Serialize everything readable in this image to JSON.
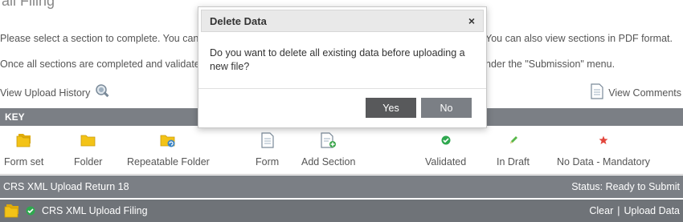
{
  "page": {
    "title": "ail Filing",
    "intro_line1_left": "Please select a section to complete. You can p",
    "intro_line1_right": "You can also view sections in PDF format.",
    "intro_line2_left": "Once all sections are completed and validated",
    "intro_line2_right": "nder the \"Submission\" menu.",
    "view_upload_history": "View Upload History",
    "view_comments": "View Comments"
  },
  "key": {
    "header": "KEY",
    "items": [
      {
        "label": "Form set",
        "icon": "folder-set-icon"
      },
      {
        "label": "Folder",
        "icon": "folder-icon"
      },
      {
        "label": "Repeatable Folder",
        "icon": "repeatable-folder-icon"
      },
      {
        "label": "Form",
        "icon": "form-icon"
      },
      {
        "label": "Add Section",
        "icon": "add-section-icon"
      },
      {
        "label": "Validated",
        "icon": "check-icon"
      },
      {
        "label": "In Draft",
        "icon": "pencil-icon"
      },
      {
        "label": "No Data - Mandatory",
        "icon": "star-icon"
      }
    ]
  },
  "returns": [
    {
      "name": "CRS XML Upload Return 18",
      "status": "Status: Ready to Submit"
    },
    {
      "name": "CRS XML Upload Filing",
      "action_clear": "Clear",
      "separator": "|",
      "action_upload": "Upload Data"
    }
  ],
  "modal": {
    "title": "Delete Data",
    "close": "×",
    "message": "Do you want to delete all existing data before uploading a new file?",
    "yes": "Yes",
    "no": "No"
  },
  "colors": {
    "bar": "#7b7f85",
    "button_yes": "#58595b",
    "button_no": "#7b7f85",
    "folder": "#f3c317",
    "validated": "#2fa84f",
    "star": "#e2453c"
  }
}
